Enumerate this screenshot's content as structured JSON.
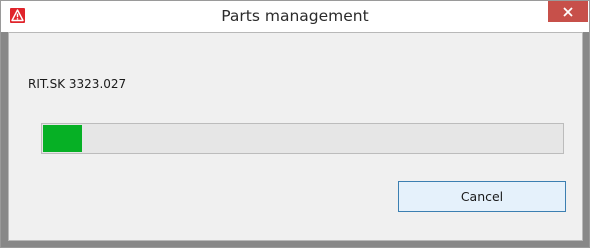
{
  "window": {
    "title": "Parts management",
    "app_icon": "warning-triangle-icon",
    "close_icon": "close-icon"
  },
  "dialog": {
    "part_number": "RIT.SK 3323.027",
    "progress_fraction": 0.075,
    "cancel_label": "Cancel"
  },
  "colors": {
    "progress_fill": "#06b025",
    "close_button": "#c7504a",
    "app_icon": "#e0242b"
  }
}
